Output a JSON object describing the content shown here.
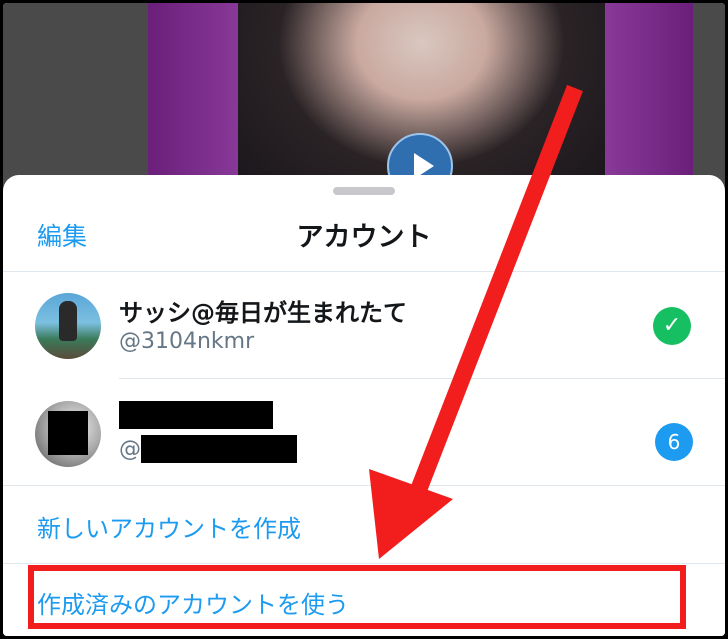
{
  "header": {
    "edit_label": "編集",
    "title": "アカウント"
  },
  "accounts": [
    {
      "name": "サッシ@毎日が生まれたて",
      "handle": "@3104nkmr",
      "status_icon": "checkmark-icon",
      "status_color": "#17bf63"
    },
    {
      "name": "",
      "handle": "@",
      "badge_count": "6",
      "badge_color": "#1d9bf0",
      "redacted": true
    }
  ],
  "actions": {
    "create_new": "新しいアカウントを作成",
    "use_existing": "作成済みのアカウントを使う"
  },
  "icons": {
    "check_glyph": "✓",
    "play": "play-icon"
  },
  "colors": {
    "accent": "#1d9bf0",
    "annotation": "#f21d1d"
  }
}
